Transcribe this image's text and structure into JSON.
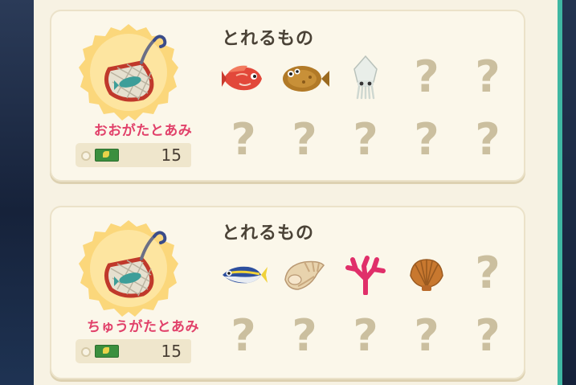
{
  "sections": [
    {
      "item_name": "おおがたとあみ",
      "price": "15",
      "catch_heading": "とれるもの",
      "catches": [
        {
          "icon": "red-snapper-icon",
          "known": true
        },
        {
          "icon": "flounder-icon",
          "known": true
        },
        {
          "icon": "squid-icon",
          "known": true
        },
        {
          "icon": "unknown-icon",
          "known": false,
          "label": "?"
        },
        {
          "icon": "unknown-icon",
          "known": false,
          "label": "?"
        },
        {
          "icon": "unknown-icon",
          "known": false,
          "label": "?"
        },
        {
          "icon": "unknown-icon",
          "known": false,
          "label": "?"
        },
        {
          "icon": "unknown-icon",
          "known": false,
          "label": "?"
        },
        {
          "icon": "unknown-icon",
          "known": false,
          "label": "?"
        },
        {
          "icon": "unknown-icon",
          "known": false,
          "label": "?"
        }
      ]
    },
    {
      "item_name": "ちゅうがたとあみ",
      "price": "15",
      "catch_heading": "とれるもの",
      "catches": [
        {
          "icon": "horse-mackerel-icon",
          "known": true
        },
        {
          "icon": "conch-shell-icon",
          "known": true
        },
        {
          "icon": "coral-icon",
          "known": true
        },
        {
          "icon": "scallop-icon",
          "known": true
        },
        {
          "icon": "unknown-icon",
          "known": false,
          "label": "?"
        },
        {
          "icon": "unknown-icon",
          "known": false,
          "label": "?"
        },
        {
          "icon": "unknown-icon",
          "known": false,
          "label": "?"
        },
        {
          "icon": "unknown-icon",
          "known": false,
          "label": "?"
        },
        {
          "icon": "unknown-icon",
          "known": false,
          "label": "?"
        },
        {
          "icon": "unknown-icon",
          "known": false,
          "label": "?"
        }
      ]
    }
  ],
  "colors": {
    "item_name": "#e1416a",
    "badge_bg": "#fbd77b",
    "unknown": "#cbbf9f",
    "accent_stripe": "#3fb7a2"
  }
}
